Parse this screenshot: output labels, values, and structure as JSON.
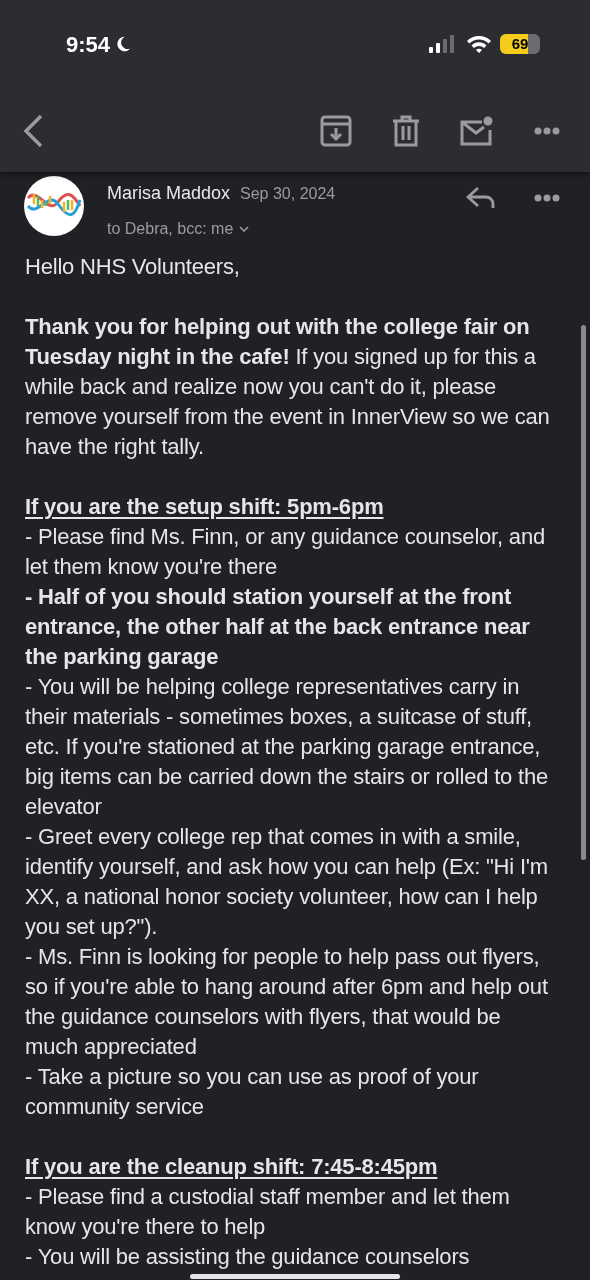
{
  "status_bar": {
    "time": "9:54",
    "battery": "69"
  },
  "message": {
    "sender": "Marisa Maddox",
    "date": "Sep 30, 2024",
    "recipients": "to Debra, bcc: me"
  },
  "body": [
    {
      "kind": "text",
      "bold": false,
      "text": "Hello NHS Volunteers,"
    },
    {
      "kind": "gap"
    },
    {
      "kind": "text",
      "bold": false,
      "text": "**Thank you for helping out with the college fair on Tuesday night in the cafe!**  If you signed up for this a while back and realize now you can't do it, please remove yourself from the event in InnerView so we can have the right tally."
    },
    {
      "kind": "gap"
    },
    {
      "kind": "heading",
      "text": "If you are the setup shift: 5pm-6pm"
    },
    {
      "kind": "text",
      "bold": false,
      "text": "- Please find Ms. Finn, or any guidance counselor, and let them know you're there"
    },
    {
      "kind": "text",
      "bold": true,
      "text": "- Half of you should station yourself at the front entrance, the other half at the back entrance near the parking garage"
    },
    {
      "kind": "text",
      "bold": false,
      "text": "- You will be helping college representatives carry in their materials - sometimes boxes, a suitcase of stuff, etc.  If you're stationed at the parking garage entrance, big items can be carried down the stairs or rolled to the elevator"
    },
    {
      "kind": "text",
      "bold": false,
      "text": "- Greet every college rep that comes in with a smile, identify yourself, and ask how you can help (Ex: \"Hi I'm XX, a national honor society volunteer, how can I help you set up?\")."
    },
    {
      "kind": "text",
      "bold": false,
      "text": "- Ms. Finn is looking for people to help pass out flyers, so if you're able to hang around after 6pm and help out the guidance counselors with flyers, that would be much appreciated"
    },
    {
      "kind": "text",
      "bold": false,
      "text": "- Take a picture so you can use as proof of your community service"
    },
    {
      "kind": "gap"
    },
    {
      "kind": "heading",
      "text": "If you are the cleanup shift: 7:45-8:45pm"
    },
    {
      "kind": "text",
      "bold": false,
      "text": "- Please find a custodial staff member and let them know you're there to help"
    },
    {
      "kind": "text",
      "bold": false,
      "text": "- You will be assisting the guidance counselors"
    }
  ]
}
